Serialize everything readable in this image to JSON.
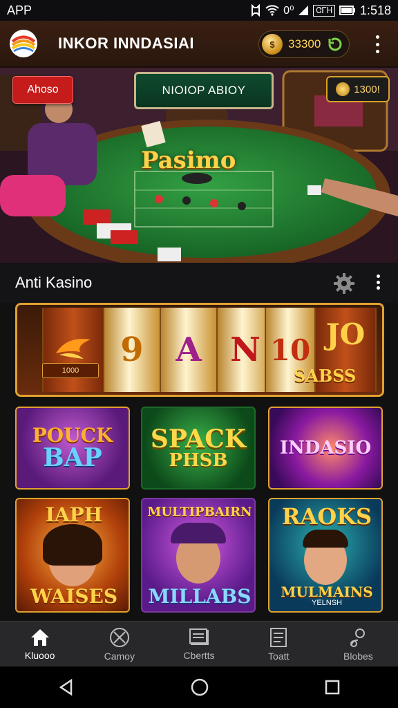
{
  "statusbar": {
    "app_name": "APP",
    "clock": "1:518",
    "status_text": "0⁰",
    "battery_text": "ᏣᎱᎻ"
  },
  "header": {
    "title": "INKOR INNDASIAI",
    "coins": "33300",
    "coin_symbol": "$"
  },
  "hero": {
    "promo_button": "Ahoso",
    "banner": "NIOIOP ABIOY",
    "bonus": "1300!",
    "table_sign": "Pasimo"
  },
  "section": {
    "title": "Anti Kasino"
  },
  "jackpot": {
    "reels": [
      "9",
      "A",
      "N",
      "10",
      "JO"
    ],
    "label": "1000",
    "subtitle": "SABSS"
  },
  "games": [
    {
      "line1": "POUCK",
      "line2": "BAP"
    },
    {
      "line1": "SPACK",
      "line2": "PHSB"
    },
    {
      "line1": "INDASIO",
      "line2": ""
    },
    {
      "line1": "IAPH",
      "line2": "WAISES"
    },
    {
      "line1": "MULTIPBAIRN",
      "line2": "MILLABS"
    },
    {
      "line1": "RAOKS",
      "line2": "MULMAINS",
      "line3": "YELNSH"
    }
  ],
  "bottom_nav": [
    {
      "label": "Kluooo",
      "icon": "home-icon"
    },
    {
      "label": "Camoy",
      "icon": "compass-icon"
    },
    {
      "label": "Cbertts",
      "icon": "cards-icon"
    },
    {
      "label": "Toatt",
      "icon": "document-icon"
    },
    {
      "label": "Blobes",
      "icon": "profile-icon"
    }
  ],
  "colors": {
    "accent_gold": "#e0a230",
    "promo_red": "#c51b1b",
    "felt_green": "#1f7a2e"
  }
}
